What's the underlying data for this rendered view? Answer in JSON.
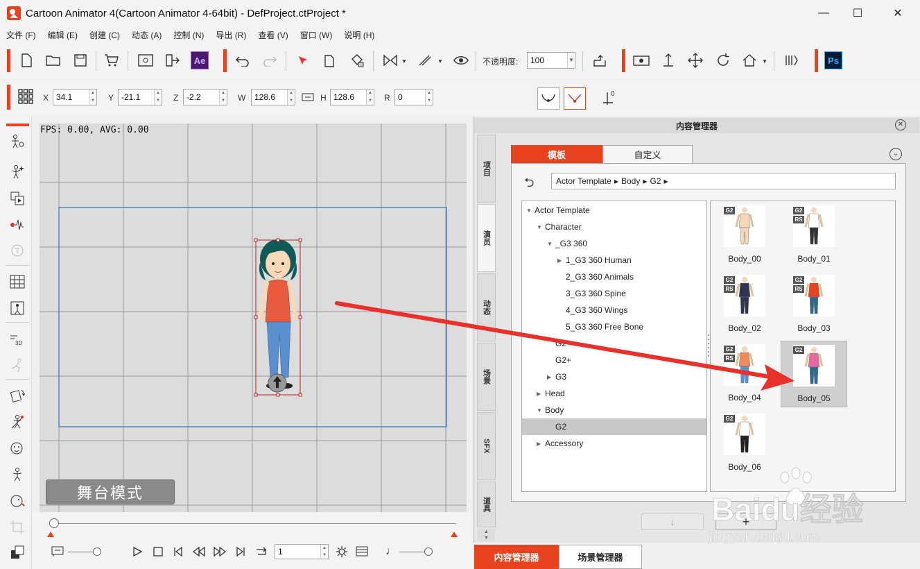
{
  "window": {
    "title": "Cartoon Animator 4(Cartoon Animator 4-64bit) - DefProject.ctProject *",
    "minimize": "—",
    "maximize": "☐",
    "close": "✕"
  },
  "menu": [
    "文件 (F)",
    "编辑 (E)",
    "创建 (C)",
    "动态 (A)",
    "控制 (N)",
    "导出 (R)",
    "查看 (V)",
    "窗口 (W)",
    "说明 (H)"
  ],
  "toolbar": {
    "ae_label": "Ae",
    "ps_label": "Ps",
    "opacity_label": "不透明度:",
    "opacity_value": "100"
  },
  "transform": {
    "x_label": "X",
    "x_value": "34.1",
    "y_label": "Y",
    "y_value": "-21.1",
    "z_label": "Z",
    "z_value": "-2.2",
    "w_label": "W",
    "w_value": "128.6",
    "h_label": "H",
    "h_value": "128.6",
    "r_label": "R",
    "r_value": "0",
    "zero_label": "0"
  },
  "stage": {
    "fps_text": "FPS: 0.00, AVG: 0.00",
    "mode_label": "舞台模式"
  },
  "timeline": {
    "frame_value": "1"
  },
  "content_manager": {
    "title": "内容管理器",
    "side_tabs": [
      "项目",
      "演员",
      "动态",
      "场景",
      "SFX",
      "道具"
    ],
    "active_side_tab": "演员",
    "tabs": {
      "template": "模板",
      "custom": "自定义"
    },
    "breadcrumb": [
      "Actor Template",
      "Body",
      "G2"
    ],
    "tree": [
      {
        "label": "Actor Template",
        "level": 0,
        "state": "open"
      },
      {
        "label": "Character",
        "level": 1,
        "state": "open"
      },
      {
        "label": "_G3 360",
        "level": 2,
        "state": "open"
      },
      {
        "label": "1_G3 360 Human",
        "level": 3,
        "state": "closed"
      },
      {
        "label": "2_G3 360 Animals",
        "level": 3,
        "state": "leaf"
      },
      {
        "label": "3_G3 360 Spine",
        "level": 3,
        "state": "leaf"
      },
      {
        "label": "4_G3 360 Wings",
        "level": 3,
        "state": "leaf"
      },
      {
        "label": "5_G3 360 Free Bone",
        "level": 3,
        "state": "leaf"
      },
      {
        "label": "G2",
        "level": 2,
        "state": "leaf"
      },
      {
        "label": "G2+",
        "level": 2,
        "state": "leaf"
      },
      {
        "label": "G3",
        "level": 2,
        "state": "closed"
      },
      {
        "label": "Head",
        "level": 1,
        "state": "closed"
      },
      {
        "label": "Body",
        "level": 1,
        "state": "open"
      },
      {
        "label": "G2",
        "level": 2,
        "state": "leaf",
        "selected": true
      },
      {
        "label": "Accessory",
        "level": 1,
        "state": "closed"
      }
    ],
    "items": [
      {
        "label": "Body_00",
        "badges": [
          "G2"
        ],
        "shirt": "#f3d7b6",
        "pants": "#f3d7b6"
      },
      {
        "label": "Body_01",
        "badges": [
          "G2",
          "RS"
        ],
        "shirt": "#ffffff",
        "pants": "#333333"
      },
      {
        "label": "Body_02",
        "badges": [
          "G2",
          "RS"
        ],
        "shirt": "#2e3550",
        "pants": "#2e3550"
      },
      {
        "label": "Body_03",
        "badges": [
          "G2",
          "RS"
        ],
        "shirt": "#e8431e",
        "pants": "#2d6a8f"
      },
      {
        "label": "Body_04",
        "badges": [
          "G2",
          "RS"
        ],
        "shirt": "#f08a5d",
        "pants": "#5a8fd0"
      },
      {
        "label": "Body_05",
        "badges": [
          "G2"
        ],
        "shirt": "#e46aa0",
        "pants": "#2d6a8f",
        "selected": true
      },
      {
        "label": "Body_06",
        "badges": [
          "G2"
        ],
        "shirt": "#ffffff",
        "pants": "#222222"
      }
    ],
    "add_button": "+",
    "down_button": "↓"
  },
  "bottom_tabs": {
    "content_manager": "内容管理器",
    "scene_manager": "场景管理器"
  },
  "watermark": {
    "brand": "Baidu经验",
    "url": "jingyan.baidu.com"
  },
  "colors": {
    "accent": "#e8431e",
    "arrow": "#e8312a"
  }
}
